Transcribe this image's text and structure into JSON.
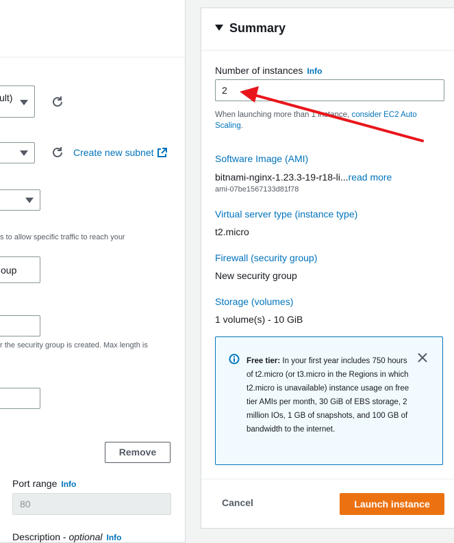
{
  "left": {
    "vpc_select_value": "ult)",
    "subnet_create_link": "Create new subnet",
    "sg_help_text": "s to allow specific traffic to reach your",
    "sg_name_value": "oup",
    "sg_desc_help": "r the security group is created. Max length is",
    "remove_label": "Remove",
    "port_range_label": "Port range",
    "port_range_info": "Info",
    "port_range_value": "80",
    "description_label": "Description - ",
    "description_optional": "optional",
    "description_info": "Info"
  },
  "summary": {
    "title": "Summary",
    "instances_label": "Number of instances",
    "instances_info": "Info",
    "instances_value": "2",
    "launch_help_prefix": "When launching more than 1 instance, ",
    "launch_help_link": "consider EC2 Auto Scaling",
    "launch_help_suffix": ".",
    "ami_label": "Software Image (AMI)",
    "ami_value": "bitnami-nginx-1.23.3-19-r18-li...",
    "ami_read_more": "read more",
    "ami_id": "ami-07be1567133d81f78",
    "instance_type_label": "Virtual server type (instance type)",
    "instance_type_value": "t2.micro",
    "firewall_label": "Firewall (security group)",
    "firewall_value": "New security group",
    "storage_label": "Storage (volumes)",
    "storage_value": "1 volume(s) - 10 GiB",
    "free_tier_bold": "Free tier:",
    "free_tier_text": " In your first year includes 750 hours of t2.micro (or t3.micro in the Regions in which t2.micro is unavailable) instance usage on free tier AMIs per month, 30 GiB of EBS storage, 2 million IOs, 1 GB of snapshots, and 100 GB of bandwidth to the internet.",
    "cancel_label": "Cancel",
    "launch_label": "Launch instance"
  },
  "colors": {
    "link": "#0073bb",
    "launch_button": "#ec7211",
    "annotation_arrow": "#e8161b"
  },
  "icons": [
    "refresh-icon",
    "external-link-icon",
    "caret-down-icon",
    "info-circle-icon",
    "close-icon",
    "expand-triangle-icon"
  ]
}
